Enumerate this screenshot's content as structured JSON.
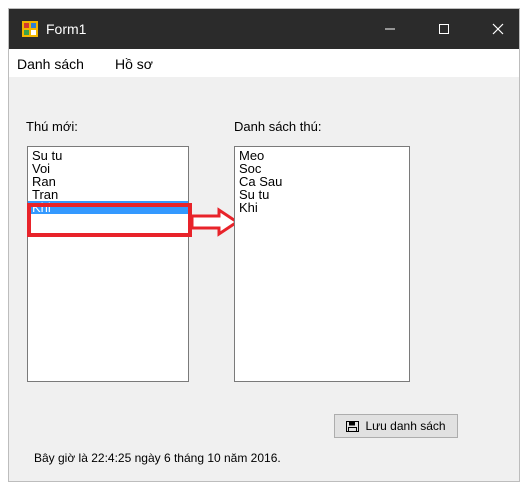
{
  "window": {
    "title": "Form1"
  },
  "menu": {
    "items": [
      "Danh sách",
      "Hồ sơ"
    ]
  },
  "new_animals": {
    "label": "Thú mới:",
    "items": [
      "Su tu",
      "Voi",
      "Ran",
      "Tran",
      "Khi"
    ],
    "selected_index": 4
  },
  "animal_list": {
    "label": "Danh sách thú:",
    "items": [
      "Meo",
      "Soc",
      "Ca Sau",
      "Su tu",
      "Khi"
    ]
  },
  "save_button": {
    "label": "Lưu danh sách",
    "icon": "save-icon"
  },
  "status": {
    "text": "Bây giờ là 22:4:25 ngày 6 tháng 10 năm 2016."
  },
  "colors": {
    "titlebar": "#2b2b2b",
    "selection": "#3399ff",
    "annotation": "#e8232a"
  }
}
